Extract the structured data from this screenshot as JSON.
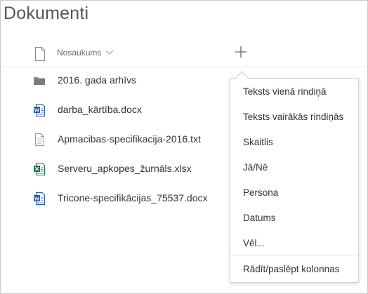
{
  "page": {
    "title": "Dokumenti"
  },
  "list_header": {
    "name_column": "Nosaukums"
  },
  "files": [
    {
      "name": "2016. gada arhīvs",
      "type": "folder-icon"
    },
    {
      "name": "darba_kārtība.docx",
      "type": "word-icon"
    },
    {
      "name": "Apmacibas-specifikacija-2016.txt",
      "type": "text-file-icon"
    },
    {
      "name": "Serveru_apkopes_žurnāls.xlsx",
      "type": "excel-icon"
    },
    {
      "name": "Tricone-specifikācijas_75537.docx",
      "type": "word-icon"
    }
  ],
  "column_menu": {
    "items": [
      "Teksts vienā rindiņā",
      "Teksts vairākās rindiņās",
      "Skaitlis",
      "Jā/Nē",
      "Persona",
      "Datums",
      "Vēl..."
    ],
    "footer": "Rādīt/paslēpt kolonnas"
  },
  "colors": {
    "word": "#2b579a",
    "excel": "#217346",
    "folder": "#8a8a8a"
  }
}
